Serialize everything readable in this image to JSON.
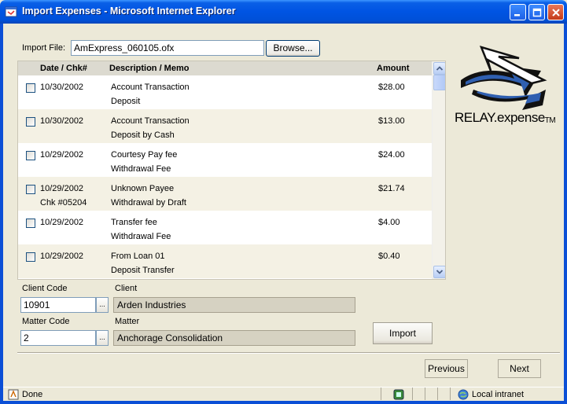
{
  "window": {
    "title": "Import Expenses - Microsoft Internet Explorer"
  },
  "import_file": {
    "label": "Import File:",
    "value": "AmExpress_060105.ofx",
    "browse_label": "Browse..."
  },
  "table": {
    "headers": {
      "date": "Date / Chk#",
      "desc": "Description / Memo",
      "amount": "Amount"
    },
    "rows": [
      {
        "date": "10/30/2002",
        "chk": "",
        "desc": "Account Transaction",
        "memo": "Deposit",
        "amount": "$28.00"
      },
      {
        "date": "10/30/2002",
        "chk": "",
        "desc": "Account Transaction",
        "memo": "Deposit by Cash",
        "amount": "$13.00"
      },
      {
        "date": "10/29/2002",
        "chk": "",
        "desc": "Courtesy Pay fee",
        "memo": "Withdrawal Fee",
        "amount": "$24.00"
      },
      {
        "date": "10/29/2002",
        "chk": "Chk #05204",
        "desc": "Unknown Payee",
        "memo": "Withdrawal by Draft",
        "amount": "$21.74"
      },
      {
        "date": "10/29/2002",
        "chk": "",
        "desc": "Transfer fee",
        "memo": "Withdrawal Fee",
        "amount": "$4.00"
      },
      {
        "date": "10/29/2002",
        "chk": "",
        "desc": "From Loan 01",
        "memo": "Deposit Transfer",
        "amount": "$0.40"
      }
    ]
  },
  "client": {
    "code_label": "Client Code",
    "code_value": "10901",
    "name_label": "Client",
    "name_value": "Arden Industries",
    "lookup": "..."
  },
  "matter": {
    "code_label": "Matter Code",
    "code_value": "2",
    "name_label": "Matter",
    "name_value": "Anchorage Consolidation",
    "lookup": "..."
  },
  "actions": {
    "import_label": "Import",
    "previous_label": "Previous",
    "next_label": "Next"
  },
  "logo": {
    "text": "RELAY",
    "suffix": ".expense",
    "tm": "TM"
  },
  "status": {
    "text": "Done",
    "zone": "Local intranet"
  },
  "colors": {
    "titlebar": "#0054e3",
    "window": "#ece9d8",
    "row_alt": "#f4f1e4",
    "readonly": "#d6d2c2"
  }
}
